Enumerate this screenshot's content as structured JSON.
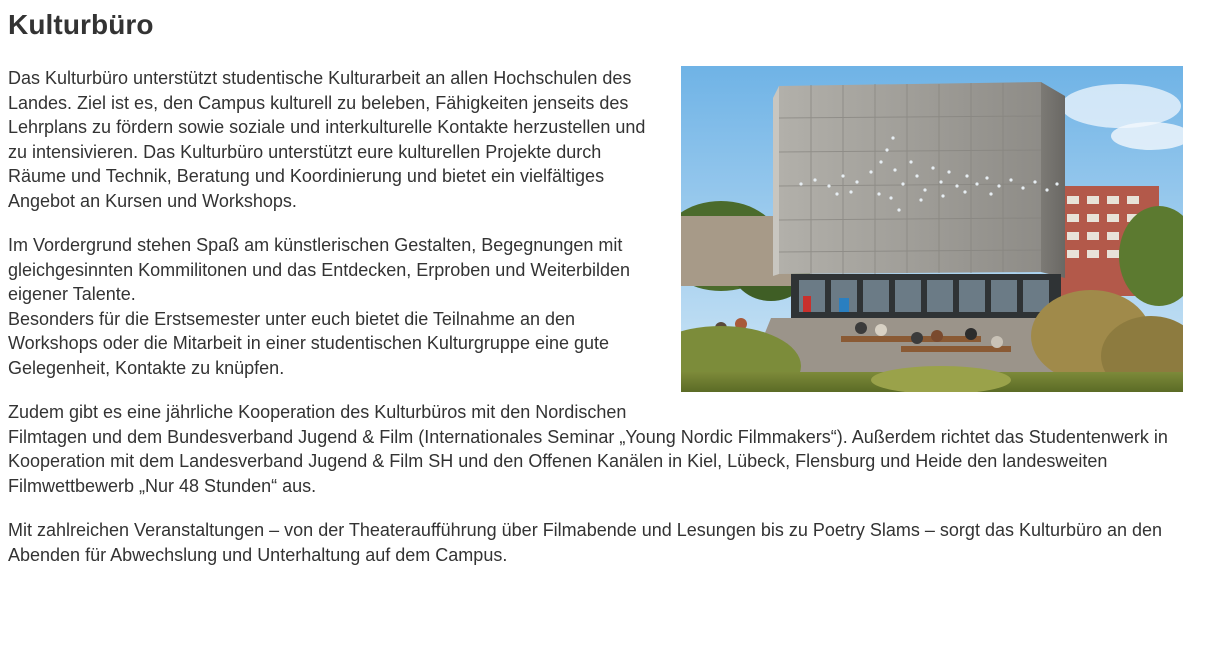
{
  "page": {
    "title": "Kulturbüro",
    "image_alt": "Kulturbüro",
    "paragraphs": [
      "Das Kulturbüro unterstützt studentische Kulturarbeit an allen Hochschulen des Landes. Ziel ist es, den Campus kulturell zu beleben, Fähigkeiten jenseits des Lehrplans zu fördern sowie soziale und interkulturelle Kontakte herzustellen und zu intensivieren. Das Kulturbüro unterstützt eure kulturellen Projekte durch Räume und Technik, Beratung und Koordinierung und bietet ein vielfältiges Angebot an Kursen und Workshops.",
      "Im Vordergrund stehen Spaß am künstlerischen Gestalten, Begegnungen mit gleichgesinnten Kommilitonen und das Entdecken, Erproben und Weiterbilden eigener Talente.",
      "Besonders für die Erstsemester unter euch bietet die Teilnahme an den Workshops oder die Mitarbeit in einer studentischen Kulturgruppe eine gute Gelegenheit, Kontakte zu knüpfen.",
      "Zudem gibt es eine jährliche Kooperation des Kulturbüros mit den Nordischen Filmtagen und dem Bundesverband Jugend & Film (Internationales Seminar „Young Nordic Filmmakers“). Außerdem richtet das Studentenwerk in Kooperation mit dem Landesverband Jugend & Film SH und den Offenen Kanälen in Kiel, Lübeck, Flensburg und Heide den landesweiten Filmwettbewerb „Nur 48 Stunden“ aus.",
      "Mit zahlreichen Veranstaltungen – von der Theateraufführung über Filmabende und Lesungen bis zu Poetry Slams – sorgt das Kulturbüro an den Abenden für Abwechslung und Unterhaltung auf dem Campus."
    ]
  },
  "colors": {
    "text": "#333333",
    "sky": "#8fc3ea",
    "concrete": "#9a9893",
    "grass": "#8a8f3a"
  }
}
